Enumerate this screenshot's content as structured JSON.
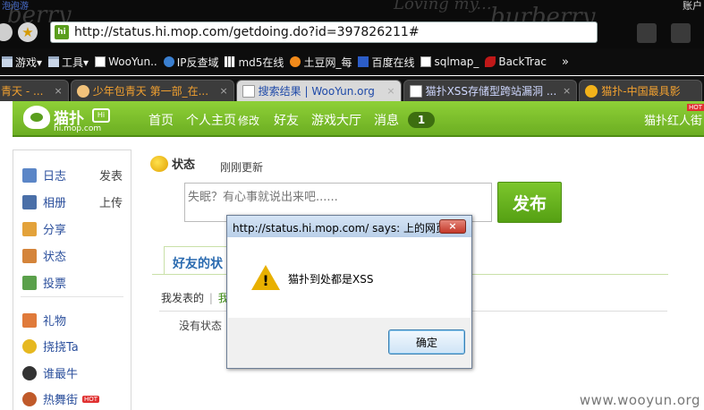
{
  "browser": {
    "top_link": "泡泡游",
    "top_right": "账户",
    "url": "http://status.hi.mop.com/getdoing.do?id=397826211#",
    "url_badge": "hi",
    "bookmarks": [
      {
        "label": "游戏▾",
        "icon": "folder-icon"
      },
      {
        "label": "工具▾",
        "icon": "folder-icon"
      },
      {
        "label": "WooYun..",
        "icon": "page-icon"
      },
      {
        "label": "IP反查域",
        "icon": "globe-icon"
      },
      {
        "label": "md5在线",
        "icon": "grid-icon"
      },
      {
        "label": "土豆网_每",
        "icon": "tudou-icon"
      },
      {
        "label": "百度在线",
        "icon": "baidu-icon"
      },
      {
        "label": "sqlmap_",
        "icon": "sqlmap-icon"
      },
      {
        "label": "BackTrac",
        "icon": "backtrack-icon"
      }
    ],
    "bookmarks_more": "»",
    "tabs": [
      {
        "label": "青天 - ...",
        "close": "×"
      },
      {
        "label": "少年包青天 第一部_在...",
        "close": "×"
      },
      {
        "label": "搜索结果 | WooYun.org",
        "close": "×"
      },
      {
        "label": "猫扑XSS存储型跨站漏洞 ...",
        "close": "×"
      },
      {
        "label": "猫扑-中国最具影",
        "close": ""
      }
    ]
  },
  "site": {
    "logo_name": "猫扑",
    "logo_badge": "Hi",
    "logo_domain": "hi.mop.com",
    "nav": {
      "home": "首页",
      "personal": "个人主页",
      "edit": "修改",
      "friends": "好友",
      "games": "游戏大厅",
      "messages": "消息",
      "message_count": "1"
    },
    "hot_label": "猫扑红人街",
    "hot_tag": "HOT"
  },
  "sidebar": {
    "items": [
      {
        "label": "日志",
        "action": "发表",
        "icon": "diary-icon",
        "color": "#5b86c7"
      },
      {
        "label": "相册",
        "action": "上传",
        "icon": "album-icon",
        "color": "#4a6fa8"
      },
      {
        "label": "分享",
        "action": "",
        "icon": "share-icon",
        "color": "#e3a23a"
      },
      {
        "label": "状态",
        "action": "",
        "icon": "status-icon",
        "color": "#d4843a"
      },
      {
        "label": "投票",
        "action": "",
        "icon": "vote-icon",
        "color": "#5aa04a"
      },
      {
        "label": "礼物",
        "action": "",
        "icon": "gift-icon",
        "color": "#e07a3a"
      },
      {
        "label": "挠挠Ta",
        "action": "",
        "icon": "tickle-icon",
        "color": "#e6b820"
      },
      {
        "label": "谁最牛",
        "action": "",
        "icon": "cow-icon",
        "color": "#333333"
      },
      {
        "label": "热舞街",
        "action": "",
        "icon": "dance-icon",
        "color": "#c05a2a",
        "badge": "HOT"
      }
    ]
  },
  "main": {
    "status_title": "状态",
    "refresh_text": "刚刚更新",
    "input_placeholder": "失眠？有心事就说出来吧......",
    "publish_label": "发布",
    "friends_tab": "好友的状",
    "my_posted": "我发表的",
    "my_posted_sep": "|",
    "my_posted_next": "我",
    "empty_text": "没有状态"
  },
  "dialog": {
    "title": "http://status.hi.mop.com/ says: 上的网页",
    "close": "×",
    "message": "猫扑到处都是XSS",
    "ok_label": "确定"
  },
  "watermark": "www.wooyun.org"
}
